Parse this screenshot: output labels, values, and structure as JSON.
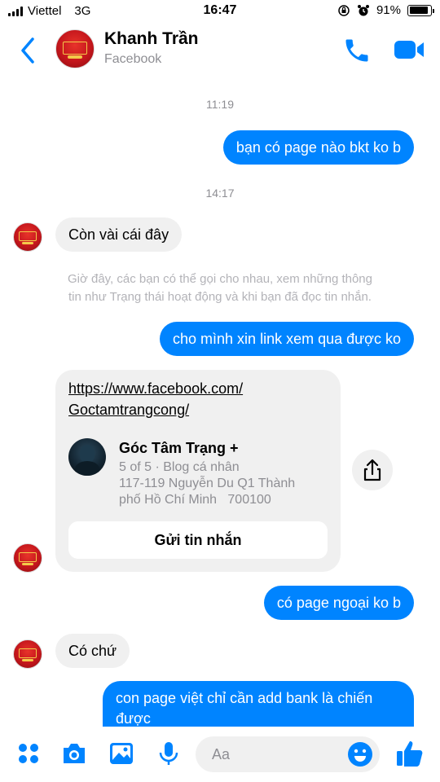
{
  "status_bar": {
    "carrier": "Viettel",
    "network": "3G",
    "time": "16:47",
    "battery": "91%",
    "battery_level": 0.91
  },
  "header": {
    "name": "Khanh Trần",
    "subtitle": "Facebook",
    "back_icon": "chevron-left-icon",
    "call_icon": "phone-icon",
    "video_icon": "video-camera-icon"
  },
  "messages": {
    "time_1": "11:19",
    "out_1": "bạn có page nào bkt ko b",
    "time_2": "14:17",
    "in_1": "Còn vài cái đây",
    "notice_line_1": "Giờ đây, các bạn có thể gọi cho nhau, xem những thông",
    "notice_line_2": "tin như Trạng thái hoạt động và khi bạn đã đọc tin nhắn.",
    "out_2": "cho mình xin link xem qua được ko",
    "out_3": "có page ngoại ko b",
    "in_2": "Có chứ",
    "out_4_line_1": "con page việt chỉ cần add bank là chiến",
    "out_4_line_2": "được"
  },
  "link_card": {
    "url_line_1": "https://www.facebook.com/",
    "url_line_2": "Goctamtrangcong/",
    "page_name": "Góc Tâm Trạng +",
    "meta_line_1": "5 of 5 · Blog cá nhân",
    "meta_line_2": "117-119 Nguyễn Du Q1 Thành",
    "meta_line_3": "phố Hồ Chí Minh   700100",
    "button_label": "Gửi tin nhắn",
    "share_icon": "share-icon"
  },
  "composer": {
    "placeholder": "Aa",
    "icons": [
      "more-dots-icon",
      "camera-icon",
      "image-icon",
      "microphone-icon",
      "emoji-icon",
      "thumbs-up-icon"
    ]
  },
  "colors": {
    "accent": "#0084ff",
    "incoming_bubble": "#f0f0f0",
    "muted_text": "#8e8e93"
  }
}
